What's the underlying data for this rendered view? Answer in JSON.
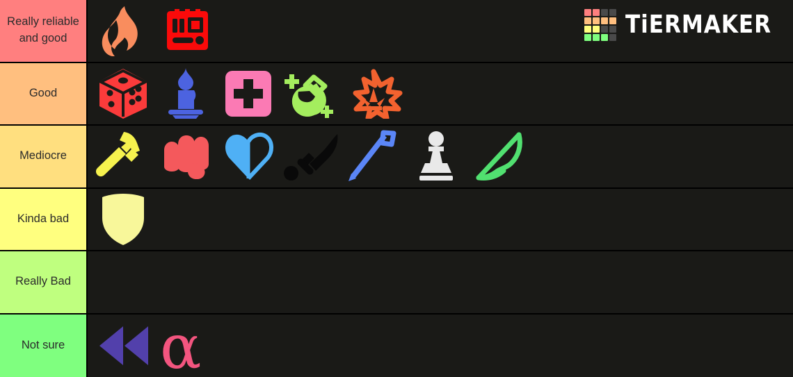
{
  "app": {
    "name": "TierMaker",
    "logo_word": "TiERMAKER",
    "logo_colors": {
      "red": "#ff7f7f",
      "orange": "#ffbf7f",
      "yellow": "#ffff7f",
      "green": "#7fff7f",
      "empty": "#4a4a4a"
    },
    "logo_grid": [
      [
        "red",
        "red",
        "empty",
        "empty"
      ],
      [
        "orange",
        "orange",
        "orange",
        "orange"
      ],
      [
        "yellow",
        "yellow",
        "empty",
        "empty"
      ],
      [
        "green",
        "green",
        "green",
        "empty"
      ]
    ]
  },
  "background_color": "#1a1a17",
  "divider_color": "#000000",
  "tiers": [
    {
      "label": "Really reliable and good",
      "color": "#ff7f7f",
      "items": [
        {
          "name": "flame-icon",
          "color": "#f98d5e"
        },
        {
          "name": "c4-explosive-icon",
          "color": "#fa0a0a"
        }
      ]
    },
    {
      "label": "Good",
      "color": "#ffbf7f",
      "items": [
        {
          "name": "dice-icon",
          "color": "#fb3b3b"
        },
        {
          "name": "candle-icon",
          "color": "#4c63e0"
        },
        {
          "name": "health-cross-icon",
          "color": "#fb7ab4"
        },
        {
          "name": "potion-flask-icon",
          "color": "#a4ed5e"
        },
        {
          "name": "explosion-burst-icon",
          "color": "#f2622f"
        }
      ]
    },
    {
      "label": "Mediocre",
      "color": "#ffdf7f",
      "items": [
        {
          "name": "hammer-icon",
          "color": "#f6f24e"
        },
        {
          "name": "fist-icon",
          "color": "#f4595c"
        },
        {
          "name": "half-heart-icon",
          "color": "#4fb0f5"
        },
        {
          "name": "sword-icon",
          "color": "#090909"
        },
        {
          "name": "spear-icon",
          "color": "#5b86f7"
        },
        {
          "name": "chess-pawn-icon",
          "color": "#e9e9e9"
        },
        {
          "name": "bow-icon",
          "color": "#51e070"
        }
      ]
    },
    {
      "label": "Kinda bad",
      "color": "#ffff7f",
      "items": [
        {
          "name": "shield-icon",
          "color": "#f8f79a"
        }
      ]
    },
    {
      "label": "Really Bad",
      "color": "#bfff7f",
      "items": []
    },
    {
      "label": "Not sure",
      "color": "#7fff7f",
      "items": [
        {
          "name": "rewind-icon",
          "color": "#5240ab"
        },
        {
          "name": "alpha-symbol-icon",
          "color": "#f3557f"
        }
      ]
    }
  ]
}
